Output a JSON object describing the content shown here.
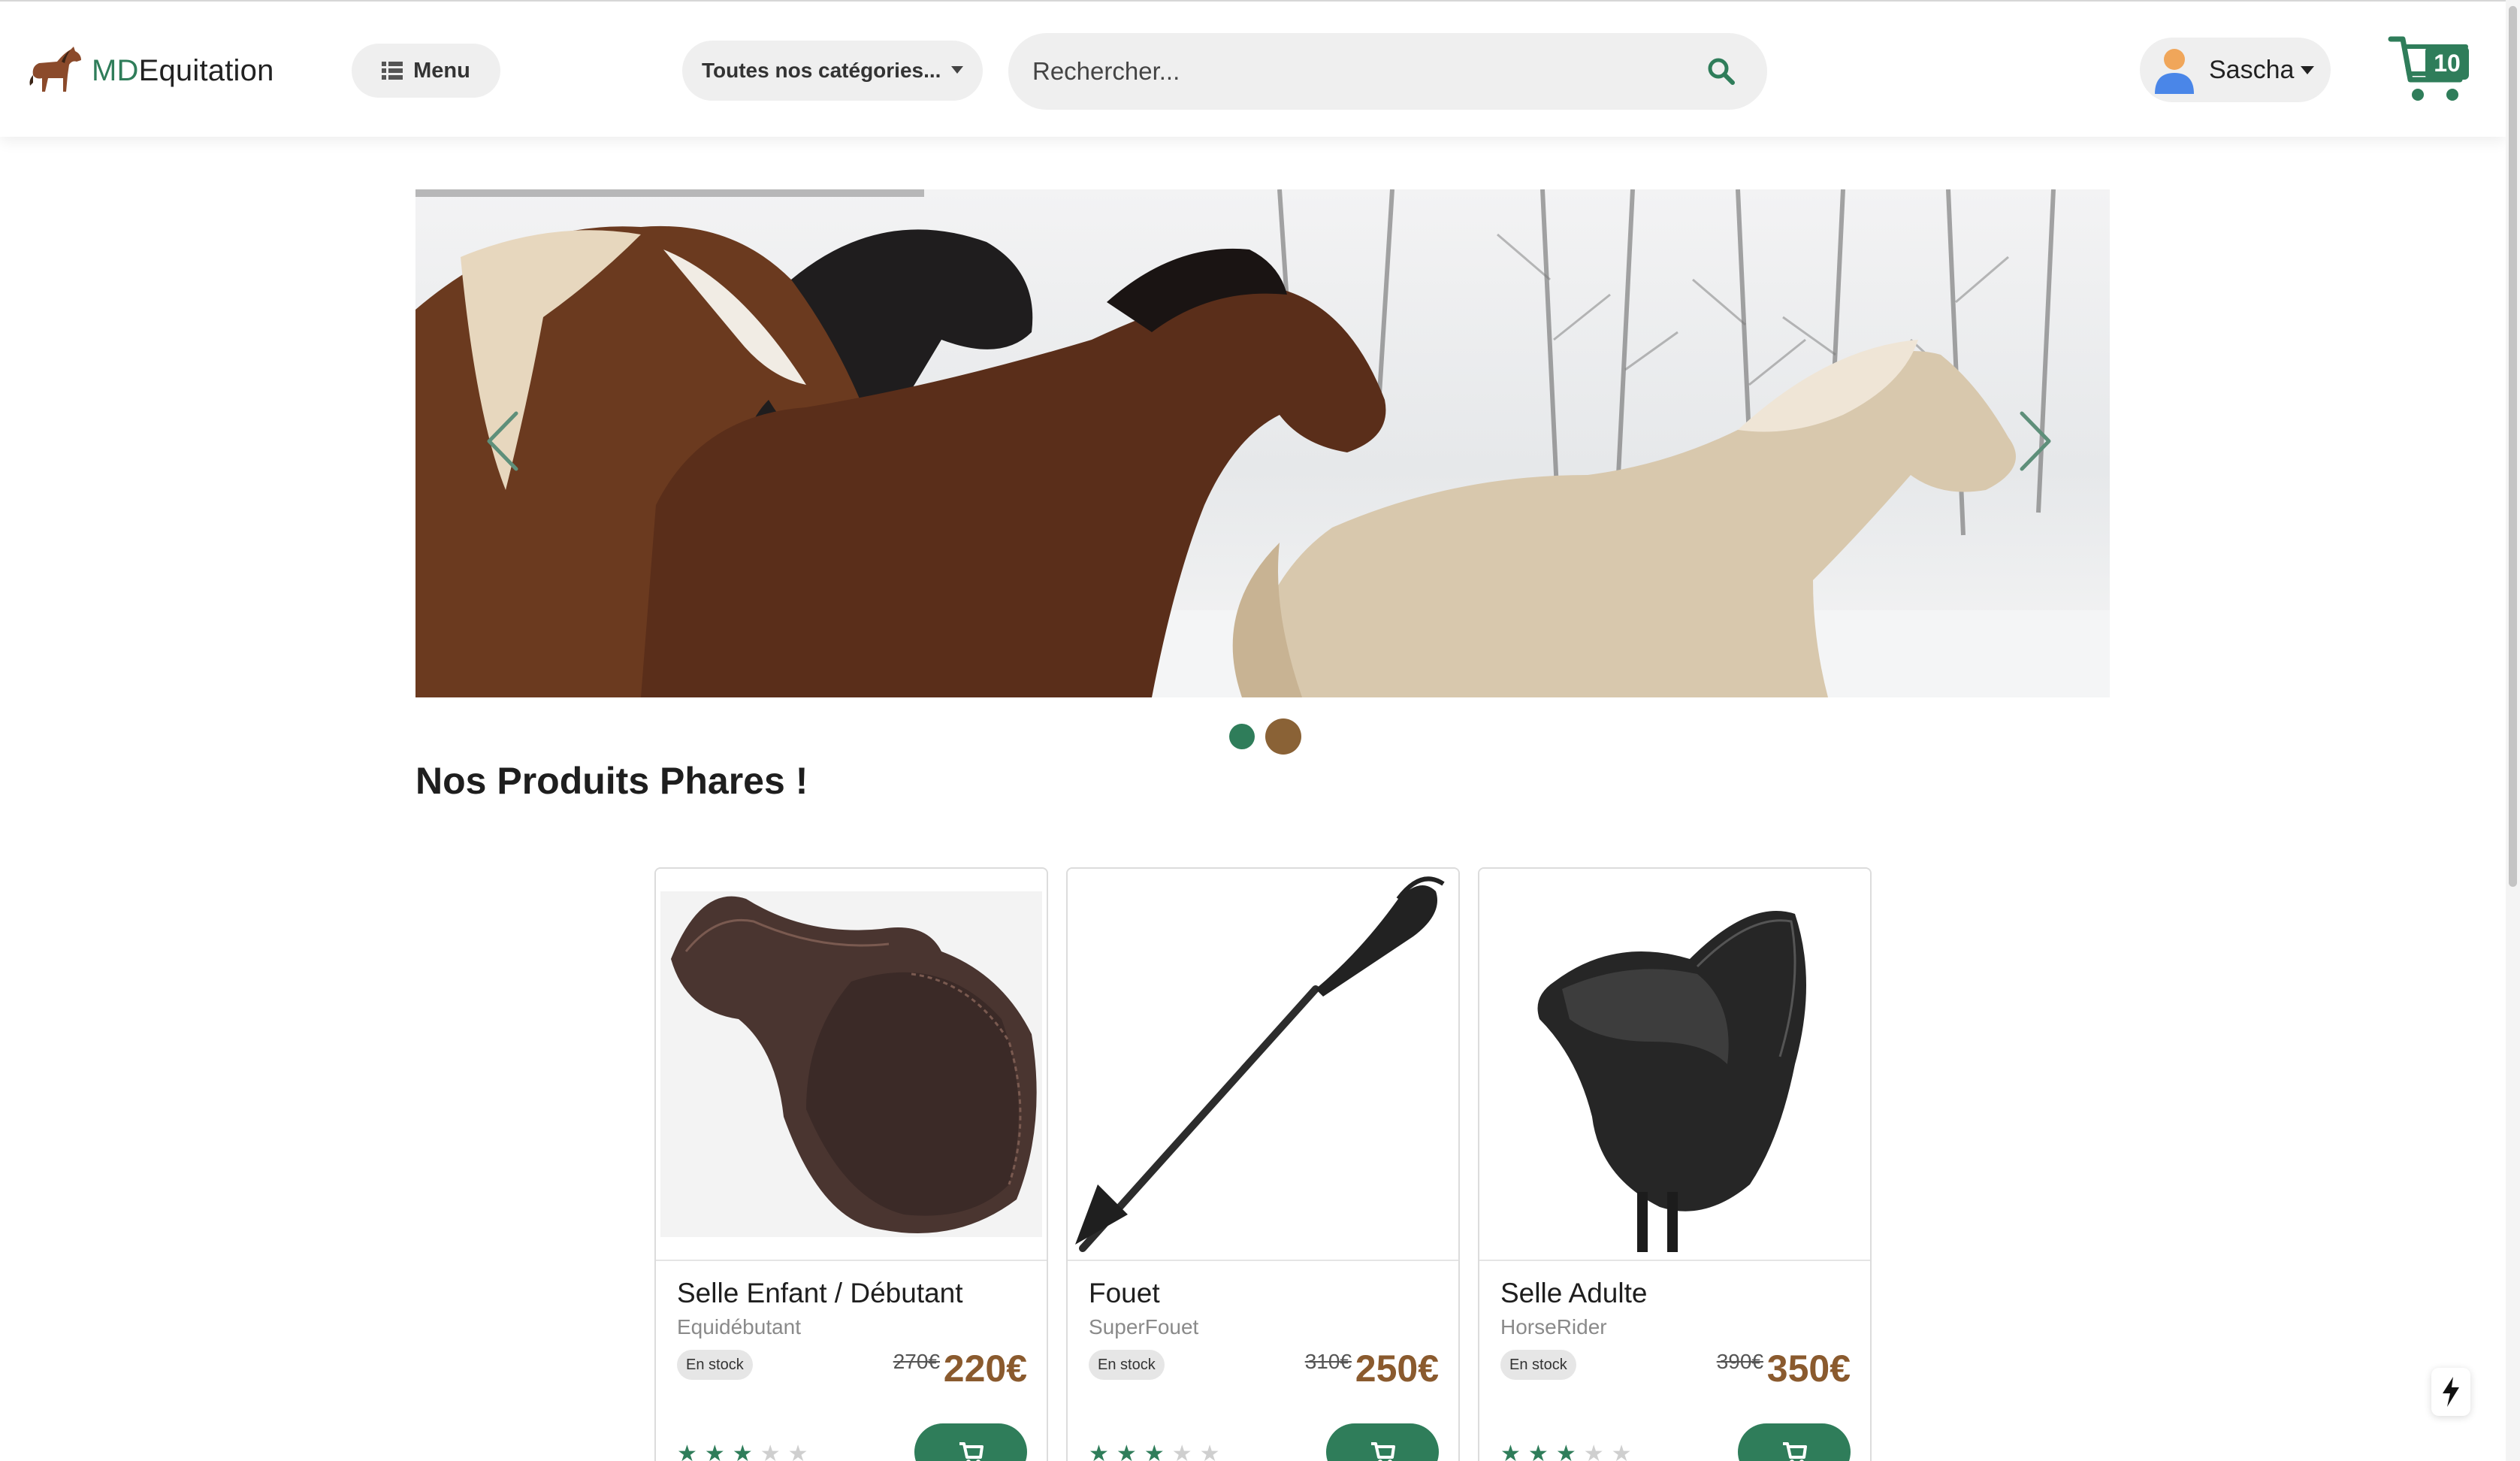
{
  "header": {
    "brand_prefix": "MD",
    "brand_suffix": "Equitation",
    "menu_label": "Menu",
    "category_select": {
      "selected": "Toutes nos catégories..."
    },
    "search": {
      "placeholder": "Rechercher...",
      "value": ""
    },
    "user": {
      "name": "Sascha"
    },
    "cart": {
      "count": "10"
    }
  },
  "carousel": {
    "slides": 2,
    "active_slide": 2,
    "progress": 0.3
  },
  "section": {
    "title": "Nos Produits Phares !"
  },
  "products": [
    {
      "name": "Selle Enfant / Débutant",
      "brand": "Equidébutant",
      "stock": "En stock",
      "old_price": "270€",
      "price": "220€",
      "rating": 3,
      "max_rating": 5
    },
    {
      "name": "Fouet",
      "brand": "SuperFouet",
      "stock": "En stock",
      "old_price": "310€",
      "price": "250€",
      "rating": 3,
      "max_rating": 5
    },
    {
      "name": "Selle Adulte",
      "brand": "HorseRider",
      "stock": "En stock",
      "old_price": "390€",
      "price": "350€",
      "rating": 3,
      "max_rating": 5
    }
  ],
  "icons": {
    "logo": "horse-icon",
    "menu": "list-icon",
    "search": "search-icon",
    "user": "user-icon",
    "cart": "cart-icon",
    "add": "add-to-cart-icon",
    "prev": "chevron-left-icon",
    "next": "chevron-right-icon",
    "flash": "lightning-icon"
  },
  "colors": {
    "accent": "#2f7d5a",
    "price": "#8a5a2e",
    "dot_active": "#8a6236"
  }
}
